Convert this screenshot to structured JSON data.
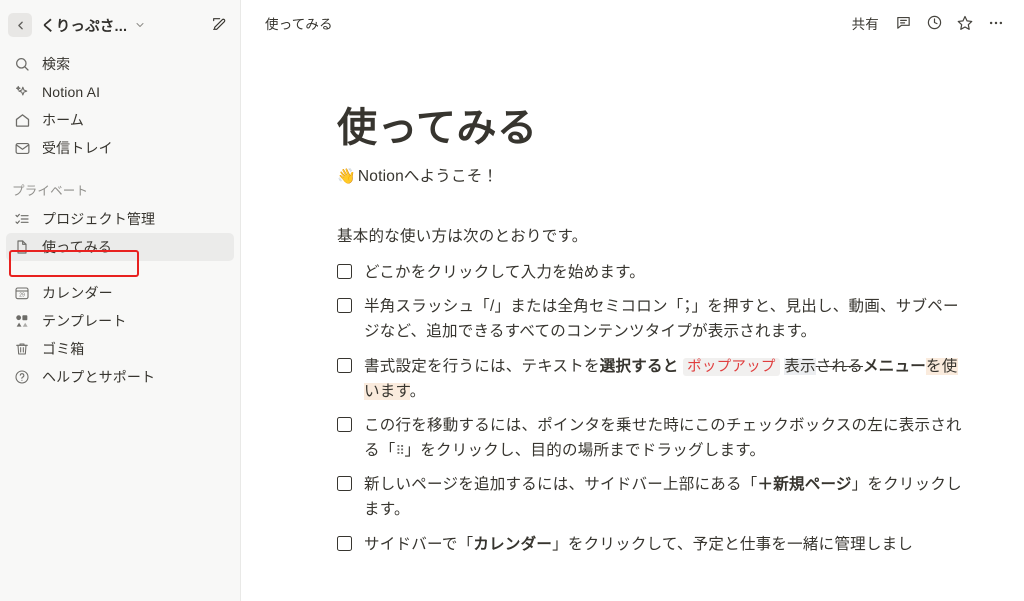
{
  "sidebar": {
    "workspace": {
      "name": "くりっぷさ...",
      "back_icon": "chevron-left-icon",
      "caret_icon": "chevron-down-icon",
      "edit_icon": "new-page-edit-icon"
    },
    "nav_items": [
      {
        "label": "検索",
        "icon": "search-icon"
      },
      {
        "label": "Notion AI",
        "icon": "sparkle-ai-icon"
      },
      {
        "label": "ホーム",
        "icon": "home-icon"
      },
      {
        "label": "受信トレイ",
        "icon": "inbox-icon"
      }
    ],
    "private_section": {
      "label": "プライベート",
      "items": [
        {
          "label": "プロジェクト管理",
          "icon": "checklist-icon",
          "selected": false
        },
        {
          "label": "使ってみる",
          "icon": "document-icon",
          "selected": true
        }
      ]
    },
    "bottom_items": [
      {
        "label": "カレンダー",
        "icon": "calendar-29-icon"
      },
      {
        "label": "テンプレート",
        "icon": "templates-icon"
      },
      {
        "label": "ゴミ箱",
        "icon": "trash-icon"
      },
      {
        "label": "ヘルプとサポート",
        "icon": "help-circle-icon"
      }
    ],
    "highlight_color": "#e8211f"
  },
  "topbar": {
    "breadcrumb": "使ってみる",
    "share_label": "共有",
    "icons": [
      {
        "name": "comment-icon"
      },
      {
        "name": "history-clock-icon"
      },
      {
        "name": "favorite-star-icon"
      },
      {
        "name": "more-options-icon"
      }
    ]
  },
  "document": {
    "title": "使ってみる",
    "welcome_emoji": "👋",
    "welcome_text": "Notionへようこそ！",
    "intro": "基本的な使い方は次のとおりです。",
    "todos": [
      {
        "id": "todo-1",
        "checked": false,
        "parts": [
          {
            "t": "どこかをクリックして入力を始めます。",
            "style": "plain"
          }
        ]
      },
      {
        "id": "todo-2",
        "checked": false,
        "parts": [
          {
            "t": "半角スラッシュ「/」または全角セミコロン「；」を押すと、見出し、動画、サブページなど、追加できるすべてのコンテンツタイプが表示されます。",
            "style": "plain"
          }
        ]
      },
      {
        "id": "todo-3",
        "checked": false,
        "parts": [
          {
            "t": "書式設定を行うには、テキストを",
            "style": "plain"
          },
          {
            "t": "選択すると",
            "style": "bold"
          },
          {
            "t": " ",
            "style": "plain"
          },
          {
            "t": "ポップアップ",
            "style": "code"
          },
          {
            "t": " ",
            "style": "plain"
          },
          {
            "t": "表示",
            "style": "underline"
          },
          {
            "t": "される",
            "style": "strike"
          },
          {
            "t": "メニュー",
            "style": "bold"
          },
          {
            "t": "を",
            "style": "highlight"
          },
          {
            "t": "使います",
            "style": "highlight"
          },
          {
            "t": "。",
            "style": "plain"
          }
        ]
      },
      {
        "id": "todo-4",
        "checked": false,
        "parts": [
          {
            "t": "この行を移動するには、ポインタを乗せた時にこのチェックボックスの左に表示される「",
            "style": "plain"
          },
          {
            "t": "⠿",
            "style": "dots"
          },
          {
            "t": "」をクリックし、目的の場所までドラッグします。",
            "style": "plain"
          }
        ]
      },
      {
        "id": "todo-5",
        "checked": false,
        "parts": [
          {
            "t": "新しいページを追加するには、サイドバー上部にある「",
            "style": "plain"
          },
          {
            "t": "＋新規ページ",
            "style": "bold"
          },
          {
            "t": "」をクリックします。",
            "style": "plain"
          }
        ]
      },
      {
        "id": "todo-6",
        "checked": false,
        "parts": [
          {
            "t": "サイドバーで「",
            "style": "plain"
          },
          {
            "t": "カレンダー",
            "style": "bold"
          },
          {
            "t": "」をクリックして、予定と仕事を一緒に管理しまし",
            "style": "plain"
          }
        ]
      }
    ]
  }
}
